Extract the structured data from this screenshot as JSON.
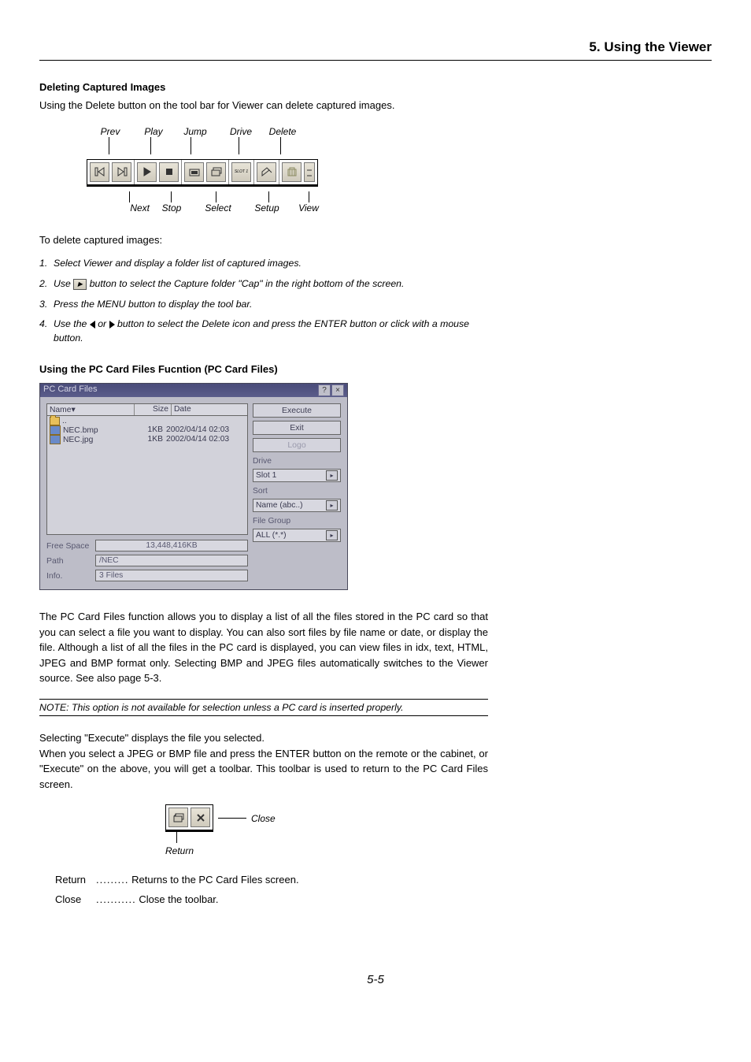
{
  "header": {
    "chapter": "5. Using the Viewer"
  },
  "section1": {
    "heading": "Deleting Captured Images",
    "intro": "Using the Delete button on the tool bar for Viewer can delete captured images.",
    "toolbar_top": {
      "prev": "Prev",
      "play": "Play",
      "jump": "Jump",
      "drive": "Drive",
      "delete": "Delete"
    },
    "toolbar_bottom": {
      "next": "Next",
      "stop": "Stop",
      "select": "Select",
      "setup": "Setup",
      "view": "View"
    },
    "slot_label": "SLOT 1",
    "lead": "To delete captured images:",
    "steps": [
      "Select Viewer and display a folder list of captured images.",
      "Use   button to select the Capture folder \"Cap\" in the right bottom of the screen.",
      "Press the MENU button to display the tool bar.",
      "Use the ◀ or ▶ button to select the Delete icon and press the ENTER button or click with a mouse button."
    ]
  },
  "section2": {
    "heading": "Using the PC Card Files Fucntion (PC Card Files)",
    "dialog": {
      "title": "PC Card Files",
      "close_glyph": "×",
      "help_glyph": "?",
      "cols": {
        "name": "Name▾",
        "size": "Size",
        "date": "Date"
      },
      "rows": [
        {
          "name": "..",
          "size": "",
          "date": "",
          "icon": "fld"
        },
        {
          "name": "NEC.bmp",
          "size": "1KB",
          "date": "2002/04/14 02:03",
          "icon": "bmp"
        },
        {
          "name": "NEC.jpg",
          "size": "1KB",
          "date": "2002/04/14 02:03",
          "icon": "bmp"
        }
      ],
      "free_label": "Free Space",
      "free_value": "13,448,416KB",
      "path_label": "Path",
      "path_value": "/NEC",
      "info_label": "Info.",
      "info_value": "3 Files",
      "btn_execute": "Execute",
      "btn_exit": "Exit",
      "btn_logo": "Logo",
      "drive_label": "Drive",
      "drive_value": "Slot 1",
      "sort_label": "Sort",
      "sort_value": "Name (abc..)",
      "group_label": "File Group",
      "group_value": "ALL (*.*)"
    },
    "para1": "The PC Card Files function allows you to display a list of all the files stored in the PC card so that you can select a file you want to display. You can also sort files by file name or date, or display the file. Although a list of all the files in the PC card is displayed, you can view files in idx, text, HTML, JPEG and BMP format only. Selecting BMP and JPEG files automatically switches to the Viewer source. See also page 5-3.",
    "note": "NOTE: This option is not available for selection unless a PC card is inserted properly.",
    "para2a": "Selecting \"Execute\" displays the file you selected.",
    "para2b": "When you select a JPEG or BMP file and press the ENTER button on the remote or the cabinet, or \"Execute\" on the above, you will get a toolbar. This toolbar is used to return to the PC Card Files screen.",
    "mini": {
      "close": "Close",
      "return": "Return"
    },
    "defs": {
      "return_term": "Return",
      "return_dots": ".........",
      "return_desc": "Returns to the PC Card Files screen.",
      "close_term": "Close",
      "close_dots": "...........",
      "close_desc": "Close the toolbar."
    }
  },
  "page": "5-5"
}
